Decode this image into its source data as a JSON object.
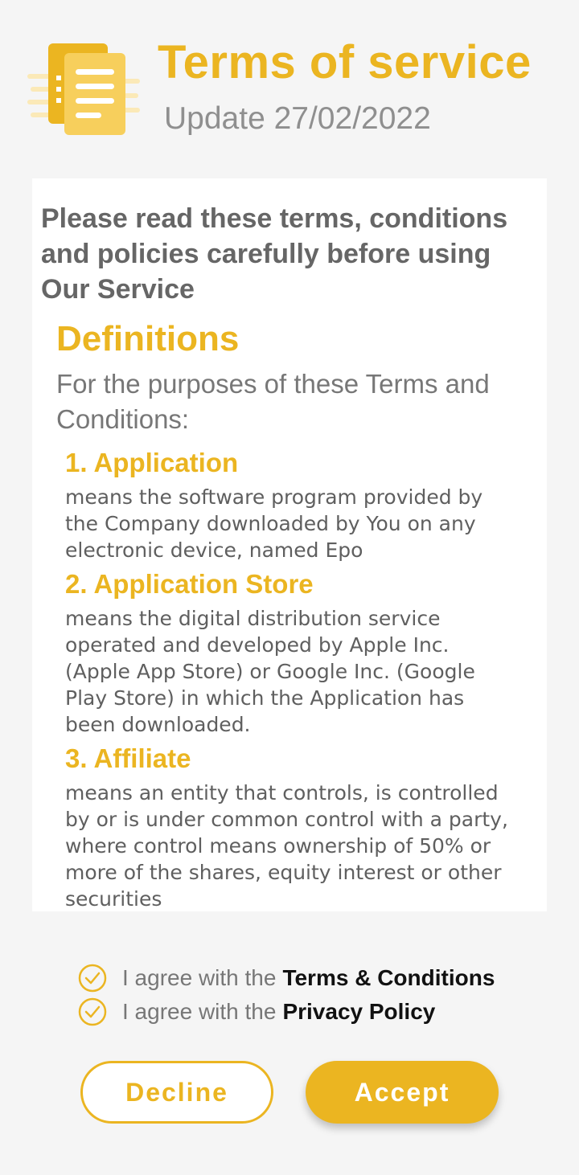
{
  "colors": {
    "accent": "#ebb521",
    "heading_gray": "#666666",
    "body_gray": "#5f5f5f",
    "background": "#f5f5f5",
    "card": "#ffffff"
  },
  "header": {
    "icon": "document-list-icon",
    "title": "Terms of service",
    "update": "Update 27/02/2022"
  },
  "content": {
    "intro": "Please read these terms, conditions and policies carefully before using Our Service",
    "section_title": "Definitions",
    "section_desc": "For the purposes of these Terms and Conditions:",
    "definitions": [
      {
        "title": "1. Application",
        "body": "means the software program provided by the Company downloaded by You on any electronic device, named Epo"
      },
      {
        "title": "2. Application Store",
        "body": "means the digital distribution service operated and developed by Apple Inc. (Apple App Store) or Google Inc. (Google Play Store) in which the Application has been downloaded."
      },
      {
        "title": "3. Affiliate",
        "body": "means an entity that controls, is controlled by or is under common control with a party, where control means ownership of 50% or more of the shares, equity interest or other securities"
      }
    ]
  },
  "agreements": [
    {
      "icon": "check-circle-icon",
      "prefix": "I agree with the",
      "link": "Terms & Conditions"
    },
    {
      "icon": "check-circle-icon",
      "prefix": "I agree with the",
      "link": "Privacy Policy"
    }
  ],
  "buttons": {
    "decline": "Decline",
    "accept": "Accept"
  }
}
